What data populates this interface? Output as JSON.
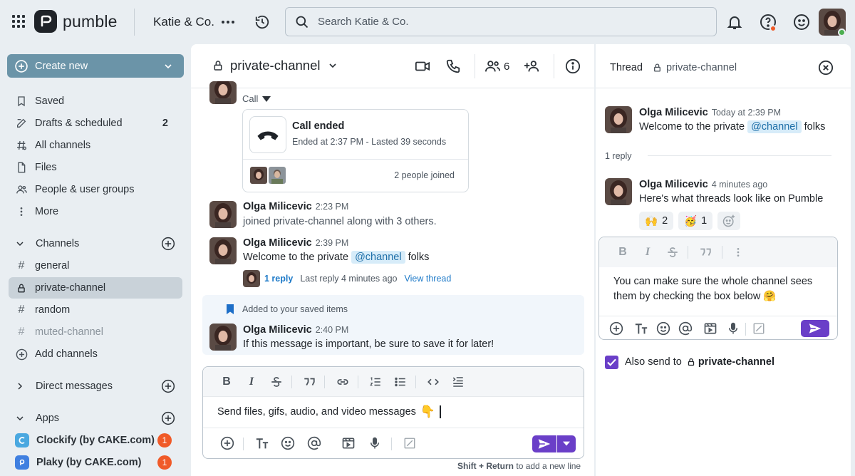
{
  "topbar": {
    "brand": "pumble",
    "workspace": "Katie & Co.",
    "search_placeholder": "Search Katie & Co."
  },
  "sidebar": {
    "create_new": "Create new",
    "items": [
      {
        "label": "Saved",
        "icon": "bookmark-icon"
      },
      {
        "label": "Drafts & scheduled",
        "icon": "edit-icon",
        "count": "2"
      },
      {
        "label": "All channels",
        "icon": "channels-icon"
      },
      {
        "label": "Files",
        "icon": "file-icon"
      },
      {
        "label": "People & user groups",
        "icon": "people-icon"
      },
      {
        "label": "More",
        "icon": "more-vertical-icon"
      }
    ],
    "channels_header": "Channels",
    "channels": [
      {
        "label": "general"
      },
      {
        "label": "private-channel",
        "active": true
      },
      {
        "label": "random"
      },
      {
        "label": "muted-channel",
        "muted": true
      }
    ],
    "add_channels": "Add channels",
    "direct_messages_header": "Direct messages",
    "apps_header": "Apps",
    "apps": [
      {
        "label": "Clockify (by CAKE.com)",
        "badge": "1",
        "color": "#4aa8e0"
      },
      {
        "label": "Plaky (by CAKE.com)",
        "badge": "1",
        "color": "#3f7fe0"
      }
    ]
  },
  "channel": {
    "name": "private-channel",
    "member_count": "6"
  },
  "messages": {
    "call_label": "Call",
    "call_title": "Call ended",
    "call_detail": "Ended at 2:37 PM - Lasted 39 seconds",
    "call_joined": "2 people joined",
    "m1_author": "Olga Milicevic",
    "m1_time": "2:23 PM",
    "m1_text": "joined private-channel along with 3 others.",
    "m2_author": "Olga Milicevic",
    "m2_time": "2:39 PM",
    "m2_text_before": "Welcome to the private",
    "m2_mention": "@channel",
    "m2_text_after": "folks",
    "m2_reply_count": "1 reply",
    "m2_last_reply": "Last reply 4 minutes ago",
    "m2_view_thread": "View thread",
    "saved_note": "Added to your saved items",
    "m3_author": "Olga Milicevic",
    "m3_time": "2:40 PM",
    "m3_text": "If this message is important, be sure to save it for later!"
  },
  "composer": {
    "text": "Send files, gifs, audio, and video messages",
    "hint_bold": "Shift + Return",
    "hint_rest": "to add a new line"
  },
  "thread": {
    "title": "Thread",
    "channel": "private-channel",
    "root_author": "Olga Milicevic",
    "root_time": "Today at 2:39 PM",
    "root_text_before": "Welcome to the private",
    "root_mention": "@channel",
    "root_text_after": "folks",
    "reply_count": "1 reply",
    "reply_author": "Olga Milicevic",
    "reply_time": "4 minutes ago",
    "reply_text": "Here's what threads look like on Pumble",
    "reactions": [
      {
        "emoji": "🙌",
        "count": "2"
      },
      {
        "emoji": "🥳",
        "count": "1"
      }
    ],
    "composer_text": "You can make sure the whole channel sees them by checking the box below",
    "also_send_label": "Also send to",
    "also_send_channel": "private-channel"
  },
  "colors": {
    "accent": "#6a3fc8",
    "create_button": "#6b94a8",
    "badge": "#f05a28",
    "mention_bg": "#d7ecf9"
  }
}
